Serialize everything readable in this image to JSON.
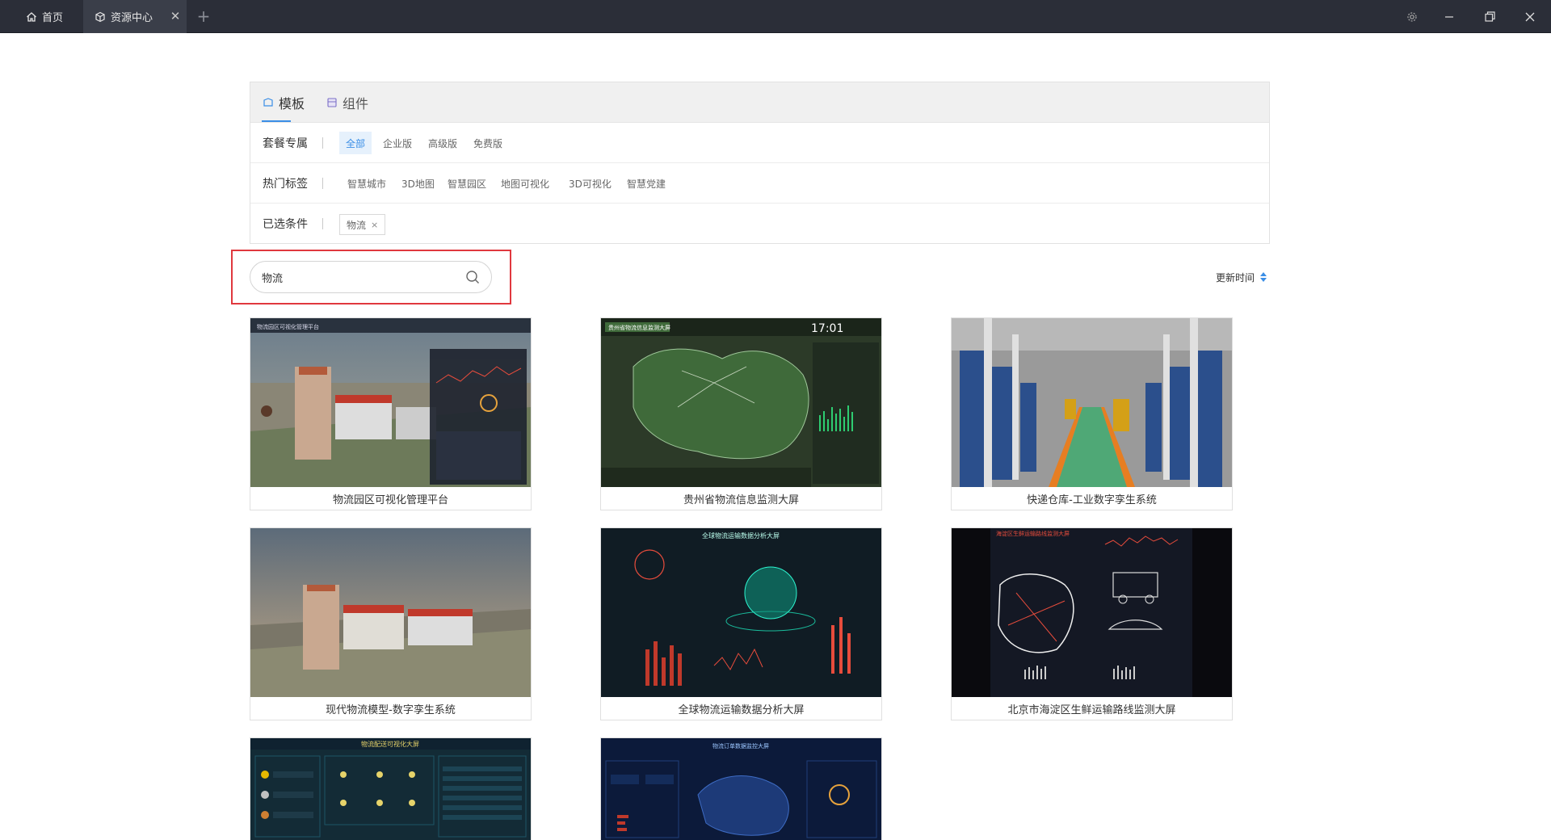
{
  "titlebar": {
    "tabs": [
      {
        "label": "首页",
        "icon": "home-icon"
      },
      {
        "label": "资源中心",
        "icon": "cube-icon",
        "active": true
      }
    ],
    "add_tab": "+",
    "close_tab": "✕"
  },
  "panel": {
    "tabs": [
      {
        "label": "模板",
        "icon": "template-icon",
        "active": true
      },
      {
        "label": "组件",
        "icon": "component-icon"
      }
    ],
    "filters": {
      "plan": {
        "label": "套餐专属",
        "options": [
          "全部",
          "企业版",
          "高级版",
          "免费版"
        ],
        "selected": "全部"
      },
      "hot_tags": {
        "label": "热门标签",
        "options": [
          "智慧城市",
          "3D地图",
          "智慧园区",
          "地图可视化",
          "3D可视化",
          "智慧党建"
        ]
      },
      "chosen": {
        "label": "已选条件",
        "tags": [
          "物流"
        ],
        "remove_glyph": "×"
      }
    }
  },
  "search": {
    "value": "物流",
    "placeholder": ""
  },
  "sort": {
    "label": "更新时间"
  },
  "cards": [
    {
      "title": "物流园区可视化管理平台",
      "thumb_title": "物流园区可视化管理平台"
    },
    {
      "title": "贵州省物流信息监测大屏",
      "thumb_title": "贵州省物流信息监测大屏",
      "thumb_time": "17:01"
    },
    {
      "title": "快递仓库-工业数字孪生系统"
    },
    {
      "title": "现代物流模型-数字孪生系统"
    },
    {
      "title": "全球物流运输数据分析大屏",
      "thumb_title": "全球物流运输数据分析大屏"
    },
    {
      "title": "北京市海淀区生鲜运输路线监测大屏",
      "thumb_title": "海淀区生鲜运输路线监测大屏"
    },
    {
      "title": "",
      "thumb_title": "物流配送可视化大屏"
    },
    {
      "title": "",
      "thumb_title": "物流订单数据监控大屏"
    }
  ],
  "colors": {
    "accent": "#3a8ee6",
    "titlebar": "#2b2e38",
    "highlight": "#e0383e",
    "sort_arrow": "#3a8ee6"
  }
}
